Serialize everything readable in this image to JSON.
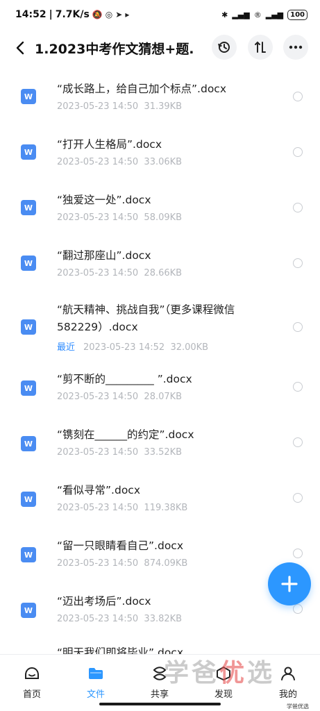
{
  "status": {
    "time": "14:52",
    "speed": "7.7K/s",
    "battery": "100"
  },
  "header": {
    "title": "1.2023中考作文猜想+题..."
  },
  "files": [
    {
      "name": "“成长路上，给自己加个标点”.docx",
      "date": "2023-05-23  14:50",
      "size": "31.39KB"
    },
    {
      "name": "“打开人生格局”.docx",
      "date": "2023-05-23  14:50",
      "size": "33.06KB"
    },
    {
      "name": "“独爱这一处”.docx",
      "date": "2023-05-23  14:50",
      "size": "58.09KB"
    },
    {
      "name": "“翻过那座山”.docx",
      "date": "2023-05-23  14:50",
      "size": "28.66KB"
    },
    {
      "name": "“航天精神、挑战自我”（更多课程微信",
      "name2": "582229）.docx",
      "badge": "最近",
      "date": "2023-05-23  14:52",
      "size": "32.00KB"
    },
    {
      "name": "“剪不断的_________ ”.docx",
      "date": "2023-05-23  14:50",
      "size": "28.07KB"
    },
    {
      "name": "“镌刻在______的约定”.docx",
      "date": "2023-05-23  14:50",
      "size": "33.52KB"
    },
    {
      "name": "“看似寻常”.docx",
      "date": "2023-05-23  14:50",
      "size": "119.38KB"
    },
    {
      "name": "“留一只眼睛看自己”.docx",
      "date": "2023-05-23  14:50",
      "size": "874.09KB"
    },
    {
      "name": "“迈出考场后”.docx",
      "date": "2023-05-23  14:50",
      "size": "33.82KB"
    },
    {
      "name": "“明天我们即将毕业”.docx"
    }
  ],
  "icons": {
    "file_type": "W"
  },
  "tabs": [
    {
      "label": "首页",
      "icon": "home-icon"
    },
    {
      "label": "文件",
      "icon": "folder-icon"
    },
    {
      "label": "共享",
      "icon": "share-icon"
    },
    {
      "label": "发现",
      "icon": "discover-icon"
    },
    {
      "label": "我的",
      "icon": "profile-icon"
    }
  ],
  "watermark": {
    "text_a": "学爸",
    "text_b": "优",
    "text_c": "选",
    "small": "学爸优选"
  },
  "colors": {
    "accent": "#2c97ff",
    "doc_icon": "#4a8cf2",
    "meta": "#b3b6bb"
  }
}
